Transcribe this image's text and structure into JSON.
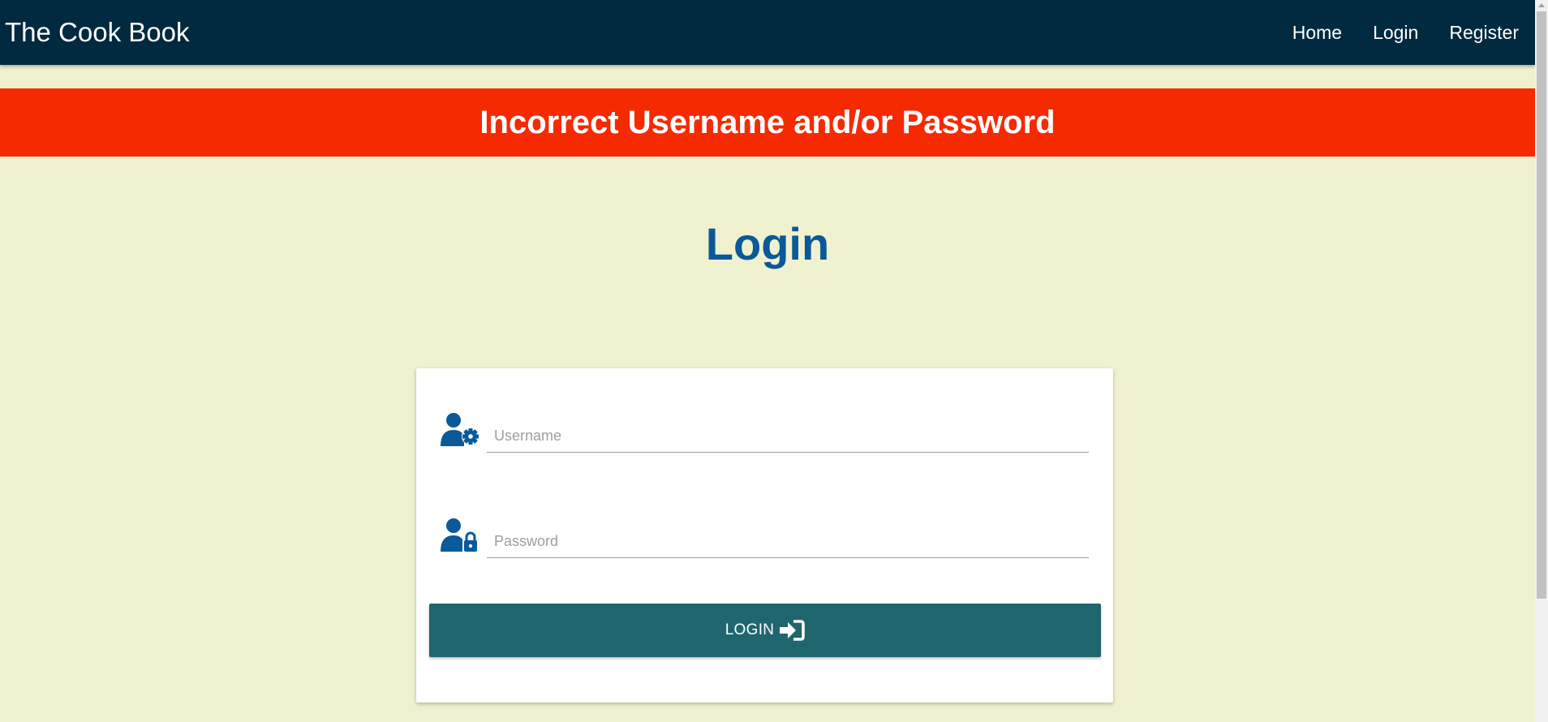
{
  "navbar": {
    "brand": "The Cook Book",
    "links": [
      "Home",
      "Login",
      "Register"
    ]
  },
  "alert": {
    "message": "Incorrect Username and/or Password"
  },
  "page": {
    "title": "Login"
  },
  "form": {
    "username_placeholder": "Username",
    "username_value": "",
    "password_placeholder": "Password",
    "password_value": "",
    "submit_label": "LOGIN"
  },
  "icons": {
    "username": "user-gear-icon",
    "password": "user-lock-icon",
    "submit": "sign-in-icon"
  },
  "colors": {
    "navbar": "#01293f",
    "page_background": "#f0f1cf",
    "alert_background": "#f62a00",
    "title": "#0a5999",
    "icon": "#0a5999",
    "button": "#20666e"
  }
}
